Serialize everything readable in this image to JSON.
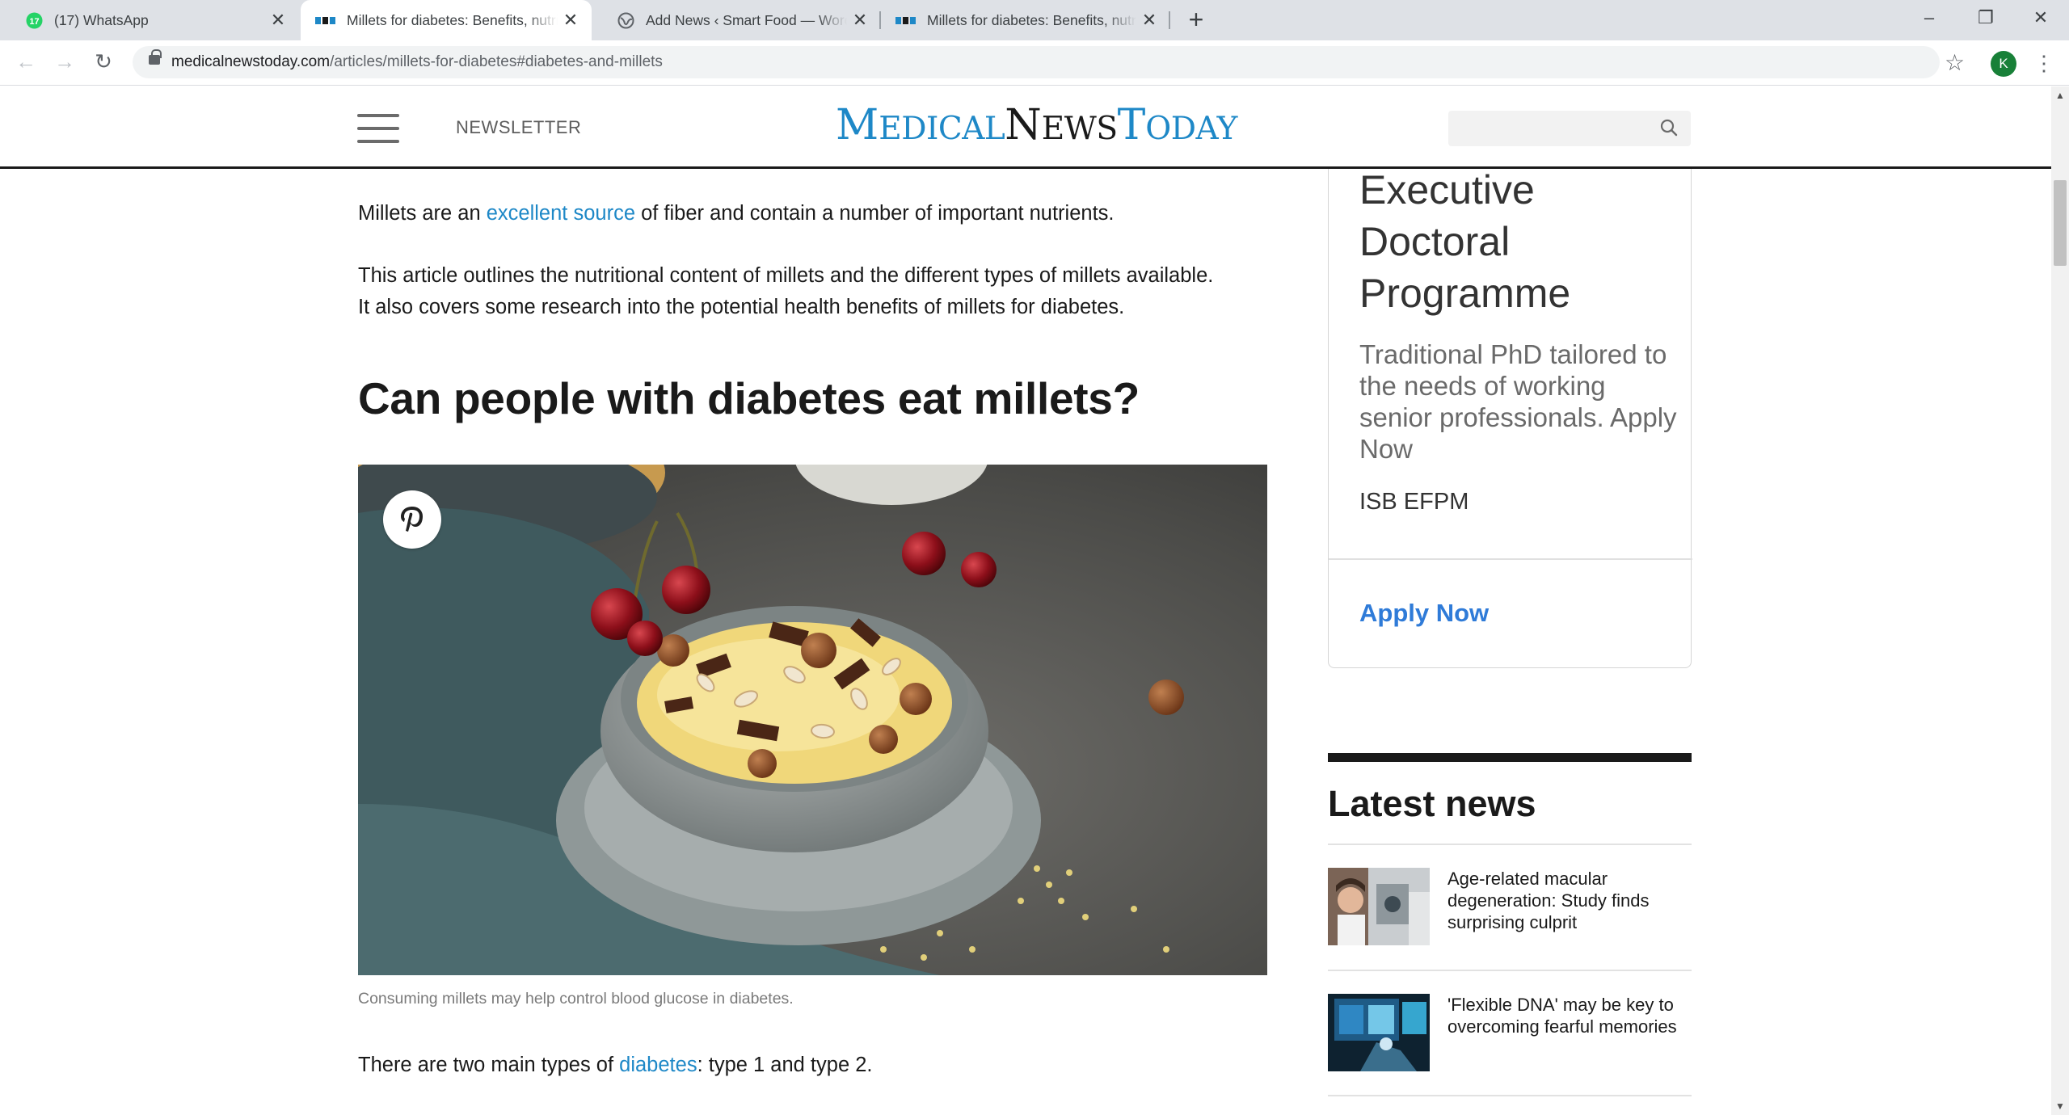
{
  "browser": {
    "tabs": [
      {
        "title": "(17) WhatsApp",
        "badge": "17",
        "active": false
      },
      {
        "title": "Millets for diabetes: Benefits, nutrition, and more",
        "active": true
      },
      {
        "title": "Add News ‹ Smart Food — WordPress",
        "active": false
      },
      {
        "title": "Millets for diabetes: Benefits, nutrition, and more",
        "active": false
      }
    ],
    "new_tab_symbol": "+",
    "window_controls": {
      "minimize": "–",
      "restore": "❐",
      "close": "✕"
    },
    "url_host": "medicalnewstoday.com",
    "url_path": "/articles/millets-for-diabetes#diabetes-and-millets",
    "profile_initial": "K",
    "colors": {
      "accent": "#1e88c7",
      "profile": "#188038",
      "whatsapp": "#25d366"
    }
  },
  "site": {
    "logo": {
      "m_cap": "M",
      "m_rest": "EDICAL",
      "n_cap": "N",
      "n_rest": "EWS",
      "t_cap": "T",
      "t_rest": "ODAY"
    },
    "newsletter": "NEWSLETTER",
    "search_placeholder": ""
  },
  "article": {
    "para1": {
      "before": "Millets are an ",
      "link": "excellent source",
      "after": " of fiber and contain a number of important nutrients."
    },
    "para2_line1": "This article outlines the nutritional content of millets and the different types of millets available.",
    "para2_line2": "It also covers some research into the potential health benefits of millets for diabetes.",
    "heading": "Can people with diabetes eat millets?",
    "image_caption": "Consuming millets may help control blood glucose in diabetes.",
    "para3": {
      "before": "There are two main types of ",
      "link": "diabetes",
      "after": ": type 1 and type 2."
    }
  },
  "sidebar": {
    "ad": {
      "title_lines": [
        "Executive",
        "Doctoral",
        "Programme"
      ],
      "body": "Traditional PhD tailored to the needs of working senior professionals. Apply Now",
      "brand": "ISB EFPM",
      "cta": "Apply Now"
    },
    "latest_news": {
      "heading": "Latest news",
      "items": [
        {
          "title": "Age-related macular degeneration: Study finds surprising culprit"
        },
        {
          "title": "'Flexible DNA' may be key to overcoming fearful memories"
        }
      ]
    }
  }
}
